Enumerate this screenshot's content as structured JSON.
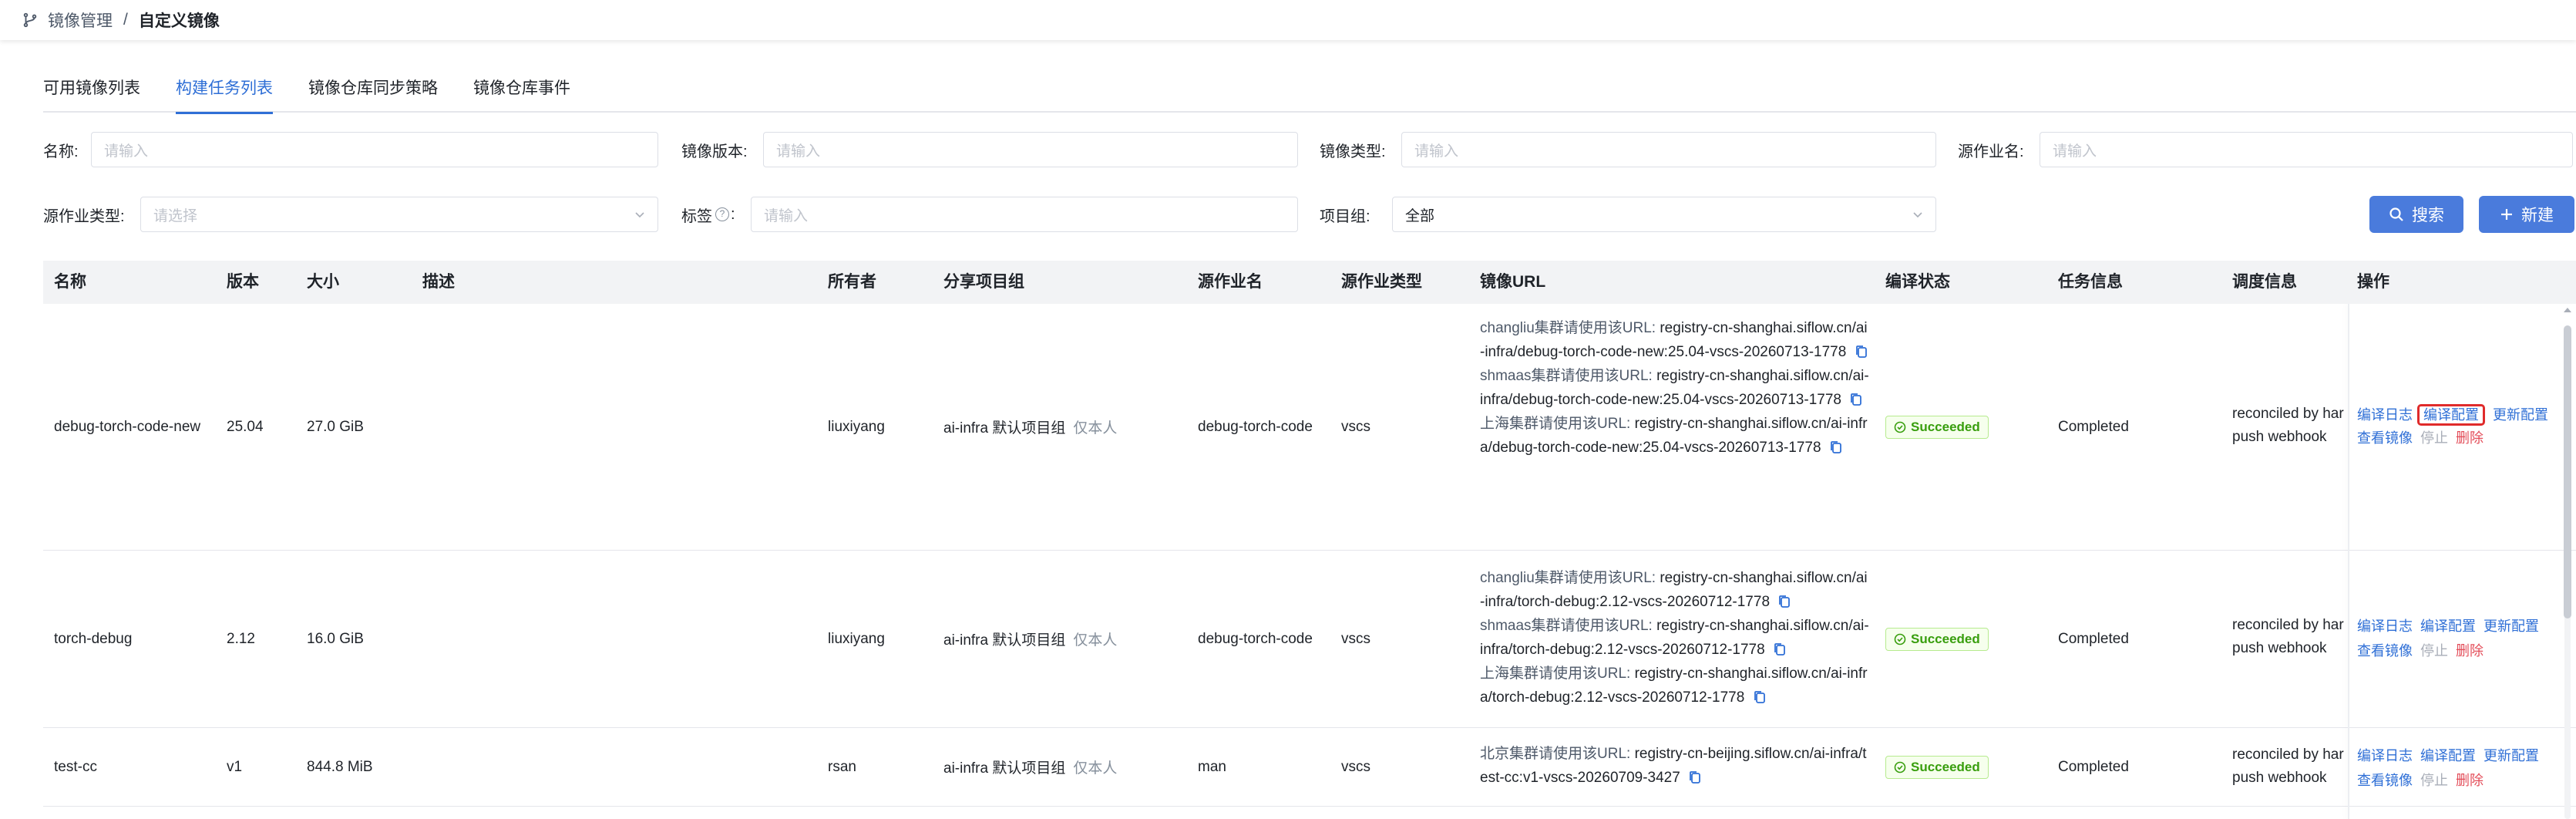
{
  "breadcrumb": {
    "parent": "镜像管理",
    "separator": "/",
    "current": "自定义镜像"
  },
  "tabs": [
    {
      "label": "可用镜像列表",
      "active": false
    },
    {
      "label": "构建任务列表",
      "active": true
    },
    {
      "label": "镜像仓库同步策略",
      "active": false
    },
    {
      "label": "镜像仓库事件",
      "active": false
    }
  ],
  "filters": {
    "name": {
      "label": "名称:",
      "placeholder": "请输入"
    },
    "version": {
      "label": "镜像版本:",
      "placeholder": "请输入"
    },
    "image_type": {
      "label": "镜像类型:",
      "placeholder": "请输入"
    },
    "source_job": {
      "label": "源作业名:",
      "placeholder": "请输入"
    },
    "source_job_type": {
      "label": "源作业类型:",
      "placeholder": "请选择"
    },
    "tags": {
      "label": "标签",
      "label_suffix": ":",
      "placeholder": "请输入"
    },
    "project_group": {
      "label": "项目组:",
      "value": "全部"
    }
  },
  "buttons": {
    "search": "搜索",
    "create": "新建"
  },
  "table": {
    "columns": [
      "名称",
      "版本",
      "大小",
      "描述",
      "所有者",
      "分享项目组",
      "源作业名",
      "源作业类型",
      "镜像URL",
      "编译状态",
      "任务信息",
      "调度信息",
      "操作"
    ],
    "rows": [
      {
        "name": "debug-torch-code-new",
        "version": "25.04",
        "size": "27.0 GiB",
        "description": "",
        "owner": "liuxiyang",
        "share_group": "ai-infra 默认项目组",
        "share_note": "仅本人",
        "source_job": "debug-torch-code",
        "source_job_type": "vscs",
        "urls": [
          {
            "label": "changliu集群请使用该URL:",
            "url": "registry-cn-shanghai.siflow.cn/ai-infra/debug-torch-code-new:25.04-vscs-20260713-1778"
          },
          {
            "label": "shmaas集群请使用该URL:",
            "url": "registry-cn-shanghai.siflow.cn/ai-infra/debug-torch-code-new:25.04-vscs-20260713-1778"
          },
          {
            "label": "上海集群请使用该URL:",
            "url": "registry-cn-shanghai.siflow.cn/ai-infra/debug-torch-code-new:25.04-vscs-20260713-1778"
          }
        ],
        "status": "Succeeded",
        "task_info": "Completed",
        "schedule_line1": "reconciled by har",
        "schedule_line2": "push webhook"
      },
      {
        "name": "torch-debug",
        "version": "2.12",
        "size": "16.0 GiB",
        "description": "",
        "owner": "liuxiyang",
        "share_group": "ai-infra 默认项目组",
        "share_note": "仅本人",
        "source_job": "debug-torch-code",
        "source_job_type": "vscs",
        "urls": [
          {
            "label": "changliu集群请使用该URL:",
            "url": "registry-cn-shanghai.siflow.cn/ai-infra/torch-debug:2.12-vscs-20260712-1778"
          },
          {
            "label": "shmaas集群请使用该URL:",
            "url": "registry-cn-shanghai.siflow.cn/ai-infra/torch-debug:2.12-vscs-20260712-1778"
          },
          {
            "label": "上海集群请使用该URL:",
            "url": "registry-cn-shanghai.siflow.cn/ai-infra/torch-debug:2.12-vscs-20260712-1778"
          }
        ],
        "status": "Succeeded",
        "task_info": "Completed",
        "schedule_line1": "reconciled by har",
        "schedule_line2": "push webhook"
      },
      {
        "name": "test-cc",
        "version": "v1",
        "size": "844.8 MiB",
        "description": "",
        "owner": "rsan",
        "share_group": "ai-infra 默认项目组",
        "share_note": "仅本人",
        "source_job": "man",
        "source_job_type": "vscs",
        "urls": [
          {
            "label": "北京集群请使用该URL:",
            "url": "registry-cn-beijing.siflow.cn/ai-infra/test-cc:v1-vscs-20260709-3427"
          }
        ],
        "status": "Succeeded",
        "task_info": "Completed",
        "schedule_line1": "reconciled by har",
        "schedule_line2": "push webhook"
      }
    ],
    "actions": {
      "build_log": "编译日志",
      "build_config": "编译配置",
      "update_config": "更新配置",
      "view_image": "查看镜像",
      "stop": "停止",
      "delete": "删除"
    }
  },
  "colors": {
    "accent": "#2f6fd6",
    "button": "#4a7bdc",
    "success": "#389e0d",
    "danger": "#e34d59",
    "highlight_box": "#e02b2b"
  },
  "icons": [
    "branch-icon",
    "question-circle-icon",
    "chevron-down-icon",
    "search-icon",
    "plus-icon",
    "copy-icon",
    "check-circle-icon"
  ]
}
